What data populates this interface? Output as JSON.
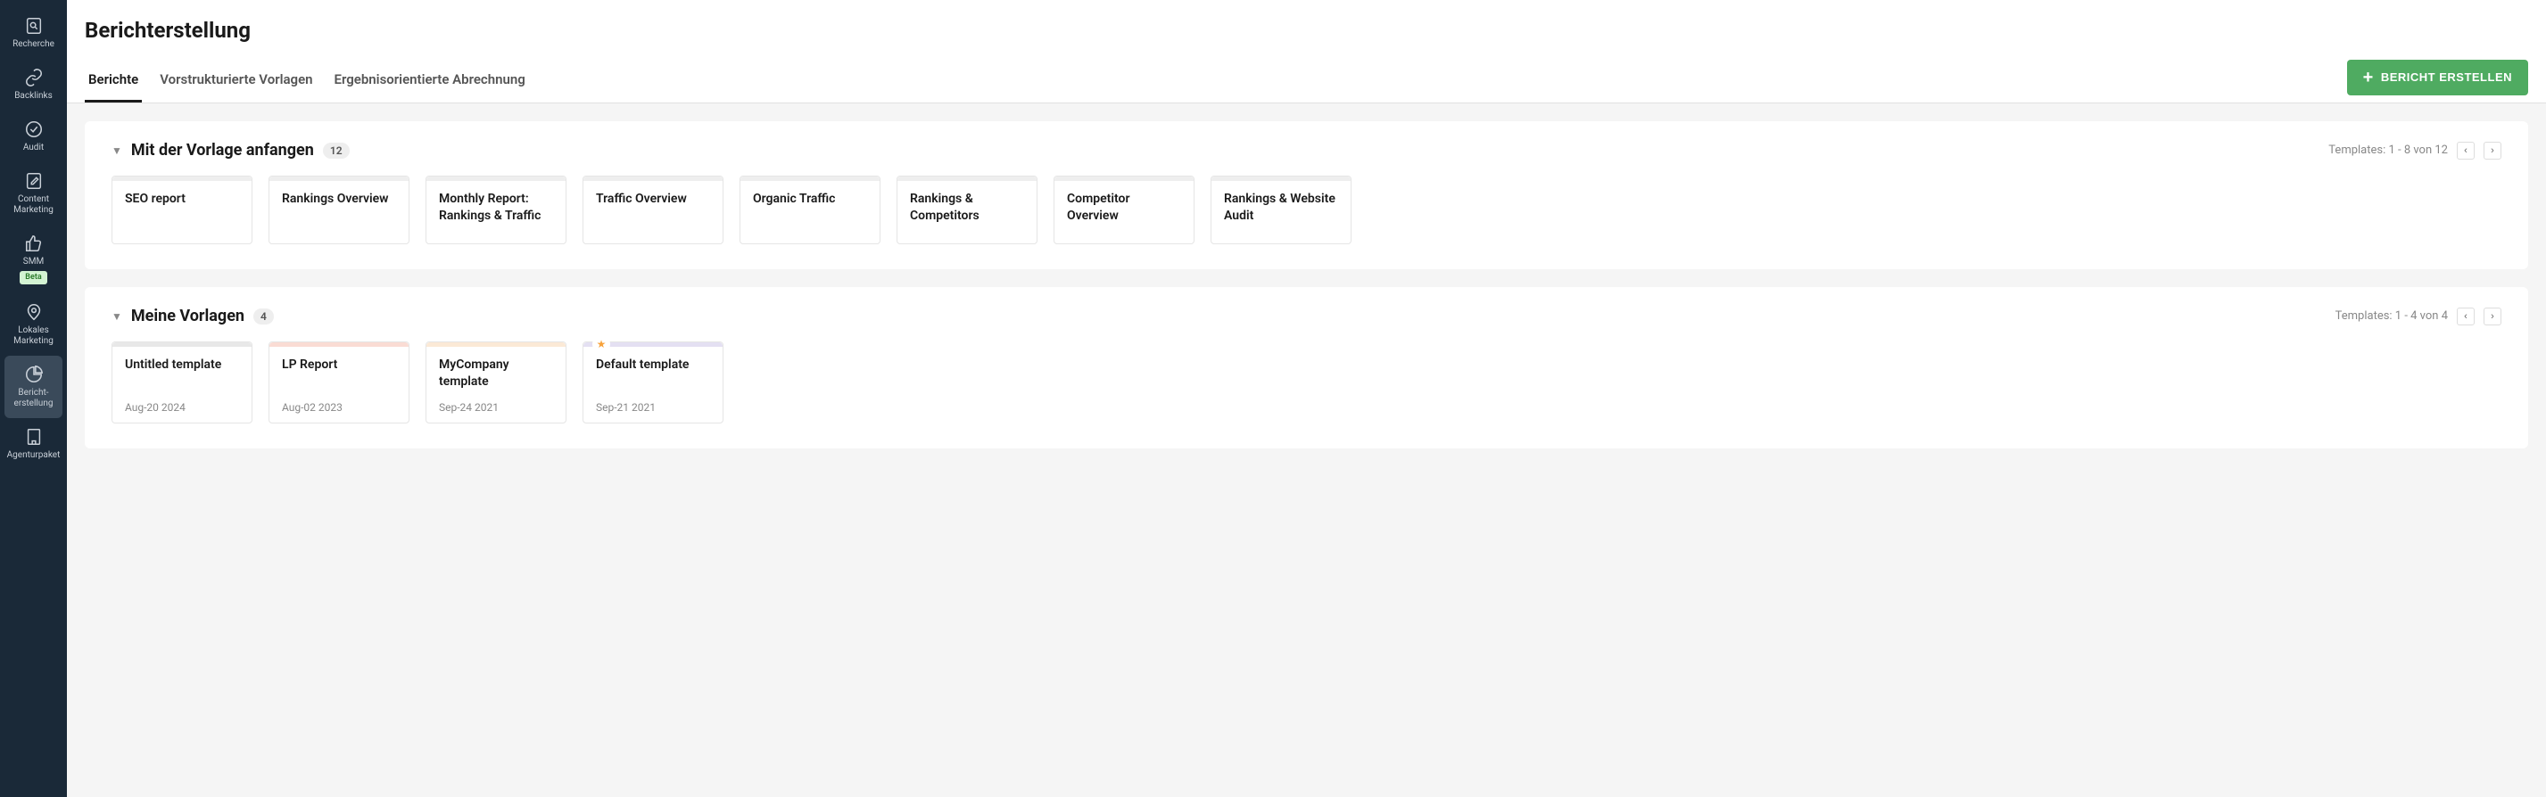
{
  "sidebar": {
    "items": [
      {
        "label": "Recherche"
      },
      {
        "label": "Backlinks"
      },
      {
        "label": "Audit"
      },
      {
        "label": "Content Marketing"
      },
      {
        "label": "SMM",
        "beta": "Beta"
      },
      {
        "label": "Lokales Marketing"
      },
      {
        "label": "Bericht-erstellung"
      },
      {
        "label": "Agenturpaket"
      }
    ]
  },
  "header": {
    "title": "Berichterstellung"
  },
  "tabs": [
    {
      "label": "Berichte"
    },
    {
      "label": "Vorstrukturierte Vorlagen"
    },
    {
      "label": "Ergebnisorientierte Abrechnung"
    }
  ],
  "create_button": "BERICHT ERSTELLEN",
  "sections": {
    "start": {
      "title": "Mit der Vorlage anfangen",
      "count": "12",
      "nav_text": "Templates: 1 - 8 von 12",
      "cards": [
        {
          "name": "SEO report"
        },
        {
          "name": "Rankings Overview"
        },
        {
          "name": "Monthly Report: Rankings & Traffic"
        },
        {
          "name": "Traffic Overview"
        },
        {
          "name": "Organic Traffic"
        },
        {
          "name": "Rankings & Competitors"
        },
        {
          "name": "Competitor Overview"
        },
        {
          "name": "Rankings & Website Audit"
        }
      ]
    },
    "mine": {
      "title": "Meine Vorlagen",
      "count": "4",
      "nav_text": "Templates: 1 - 4 von 4",
      "cards": [
        {
          "name": "Untitled template",
          "date": "Aug-20 2024"
        },
        {
          "name": "LP Report",
          "date": "Aug-02 2023"
        },
        {
          "name": "MyCompany template",
          "date": "Sep-24 2021"
        },
        {
          "name": "Default template",
          "date": "Sep-21 2021"
        }
      ]
    }
  }
}
